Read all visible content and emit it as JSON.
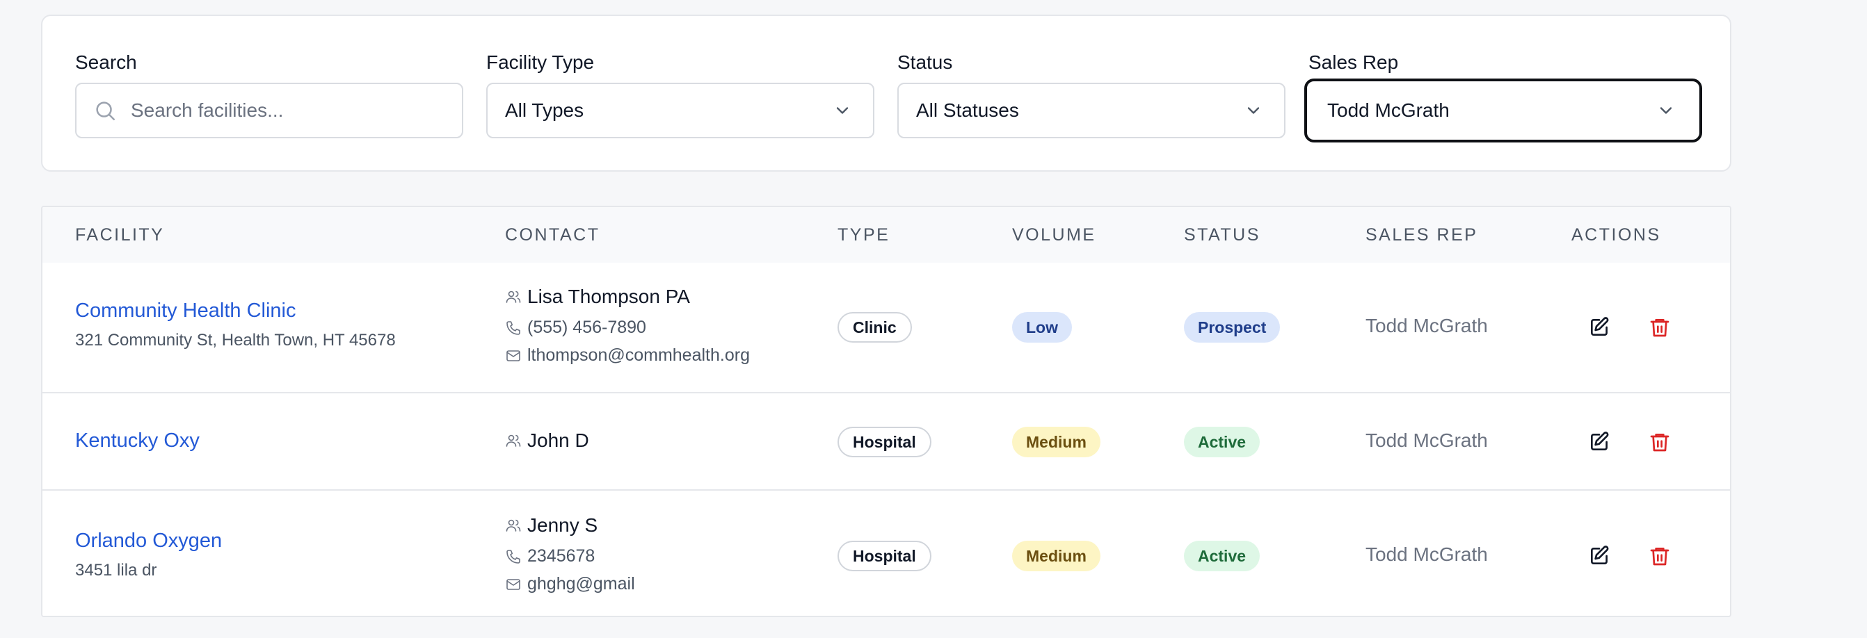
{
  "filters": {
    "search": {
      "label": "Search",
      "placeholder": "Search facilities...",
      "value": ""
    },
    "facility_type": {
      "label": "Facility Type",
      "value": "All Types"
    },
    "status": {
      "label": "Status",
      "value": "All Statuses"
    },
    "sales_rep": {
      "label": "Sales Rep",
      "value": "Todd McGrath"
    }
  },
  "table": {
    "headers": [
      "FACILITY",
      "CONTACT",
      "TYPE",
      "VOLUME",
      "STATUS",
      "SALES REP",
      "ACTIONS"
    ],
    "rows": [
      {
        "facility": "Community Health Clinic",
        "address": "321 Community St, Health Town, HT 45678",
        "contact_name": "Lisa Thompson PA",
        "phone": "(555) 456-7890",
        "email": "lthompson@commhealth.org",
        "type": "Clinic",
        "volume": "Low",
        "status": "Prospect",
        "sales_rep": "Todd McGrath"
      },
      {
        "facility": "Kentucky Oxy",
        "address": "",
        "contact_name": "John D",
        "phone": "",
        "email": "",
        "type": "Hospital",
        "volume": "Medium",
        "status": "Active",
        "sales_rep": "Todd McGrath"
      },
      {
        "facility": "Orlando Oxygen",
        "address": "3451 lila dr",
        "contact_name": "Jenny S",
        "phone": "2345678",
        "email": "ghghg@gmail",
        "type": "Hospital",
        "volume": "Medium",
        "status": "Active",
        "sales_rep": "Todd McGrath"
      }
    ]
  },
  "colors": {
    "link": "#2359d6",
    "delete": "#dc2626",
    "badge_blue_bg": "#dbe6fb",
    "badge_yellow_bg": "#fdf5c4",
    "badge_green_bg": "#def7e6"
  },
  "icons": [
    "search-icon",
    "chevron-down-icon",
    "user-icon",
    "phone-icon",
    "mail-icon",
    "edit-icon",
    "trash-icon"
  ]
}
